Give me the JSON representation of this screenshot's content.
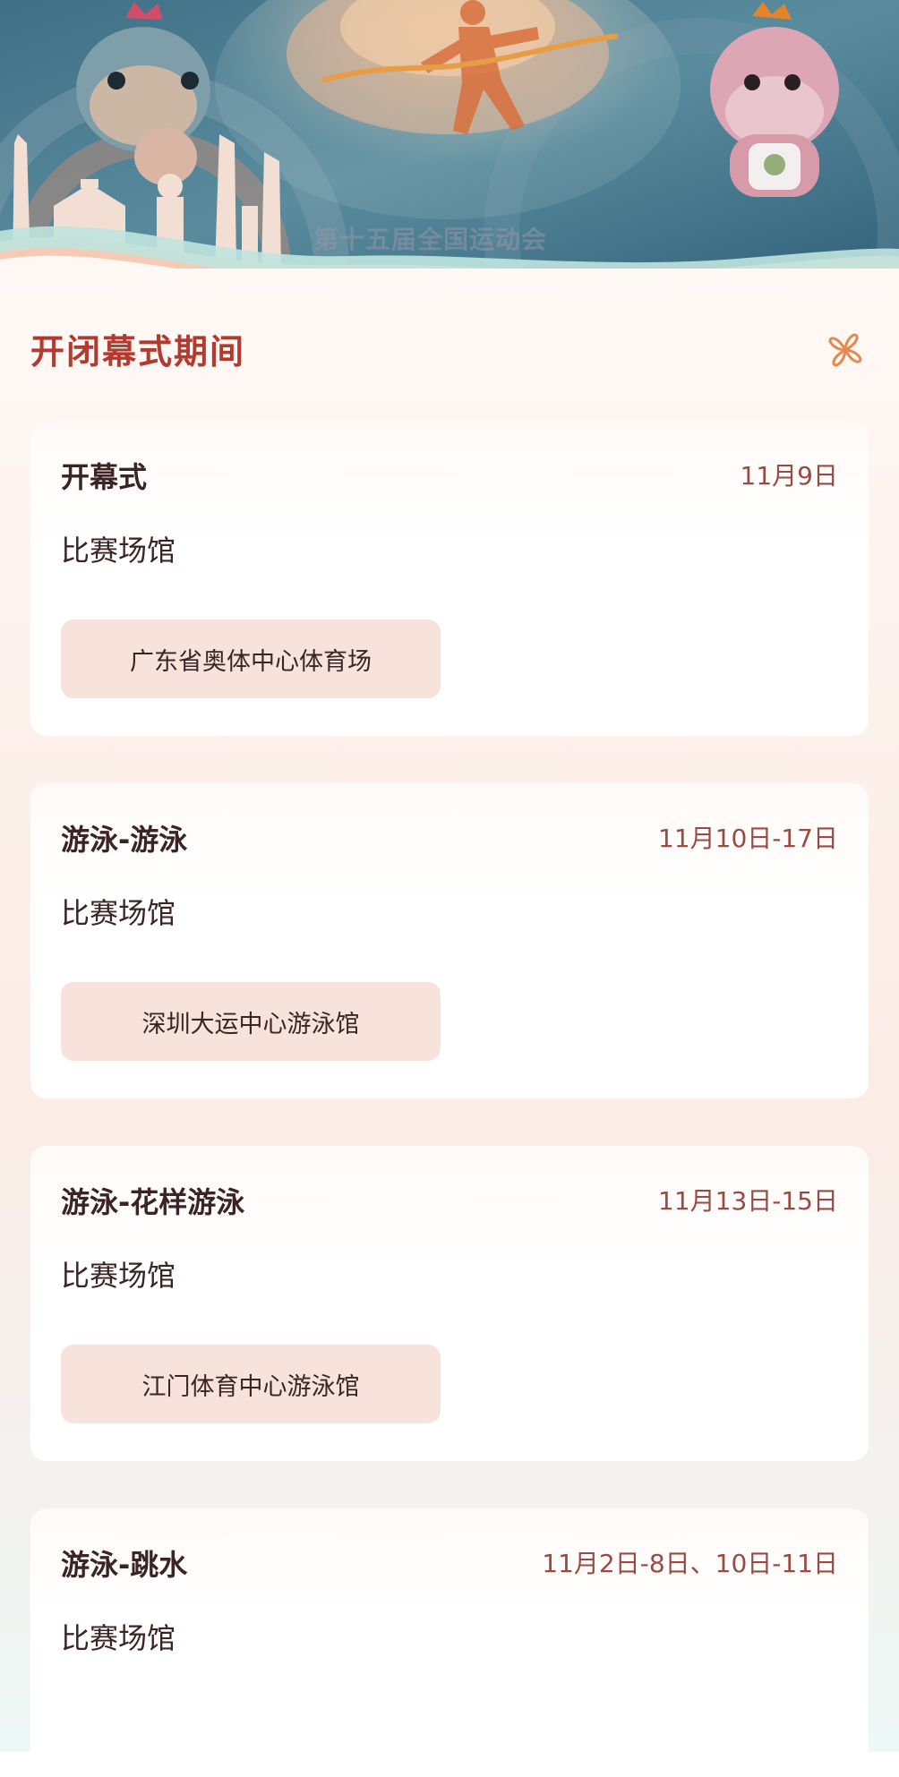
{
  "banner": {
    "caption": "第十五届全国运动会"
  },
  "section": {
    "title": "开闭幕式期间",
    "icon": "flower-icon"
  },
  "colors": {
    "title_red": "#b23a2e",
    "chip_bg": "#f8e2dc",
    "date_text": "#9a4a40"
  },
  "events": [
    {
      "name": "开幕式",
      "date": "11月9日",
      "venue_label": "比赛场馆",
      "venue": "广东省奥体中心体育场"
    },
    {
      "name": "游泳-游泳",
      "date": "11月10日-17日",
      "venue_label": "比赛场馆",
      "venue": "深圳大运中心游泳馆"
    },
    {
      "name": "游泳-花样游泳",
      "date": "11月13日-15日",
      "venue_label": "比赛场馆",
      "venue": "江门体育中心游泳馆"
    },
    {
      "name": "游泳-跳水",
      "date": "11月2日-8日、10日-11日",
      "venue_label": "比赛场馆"
    }
  ]
}
